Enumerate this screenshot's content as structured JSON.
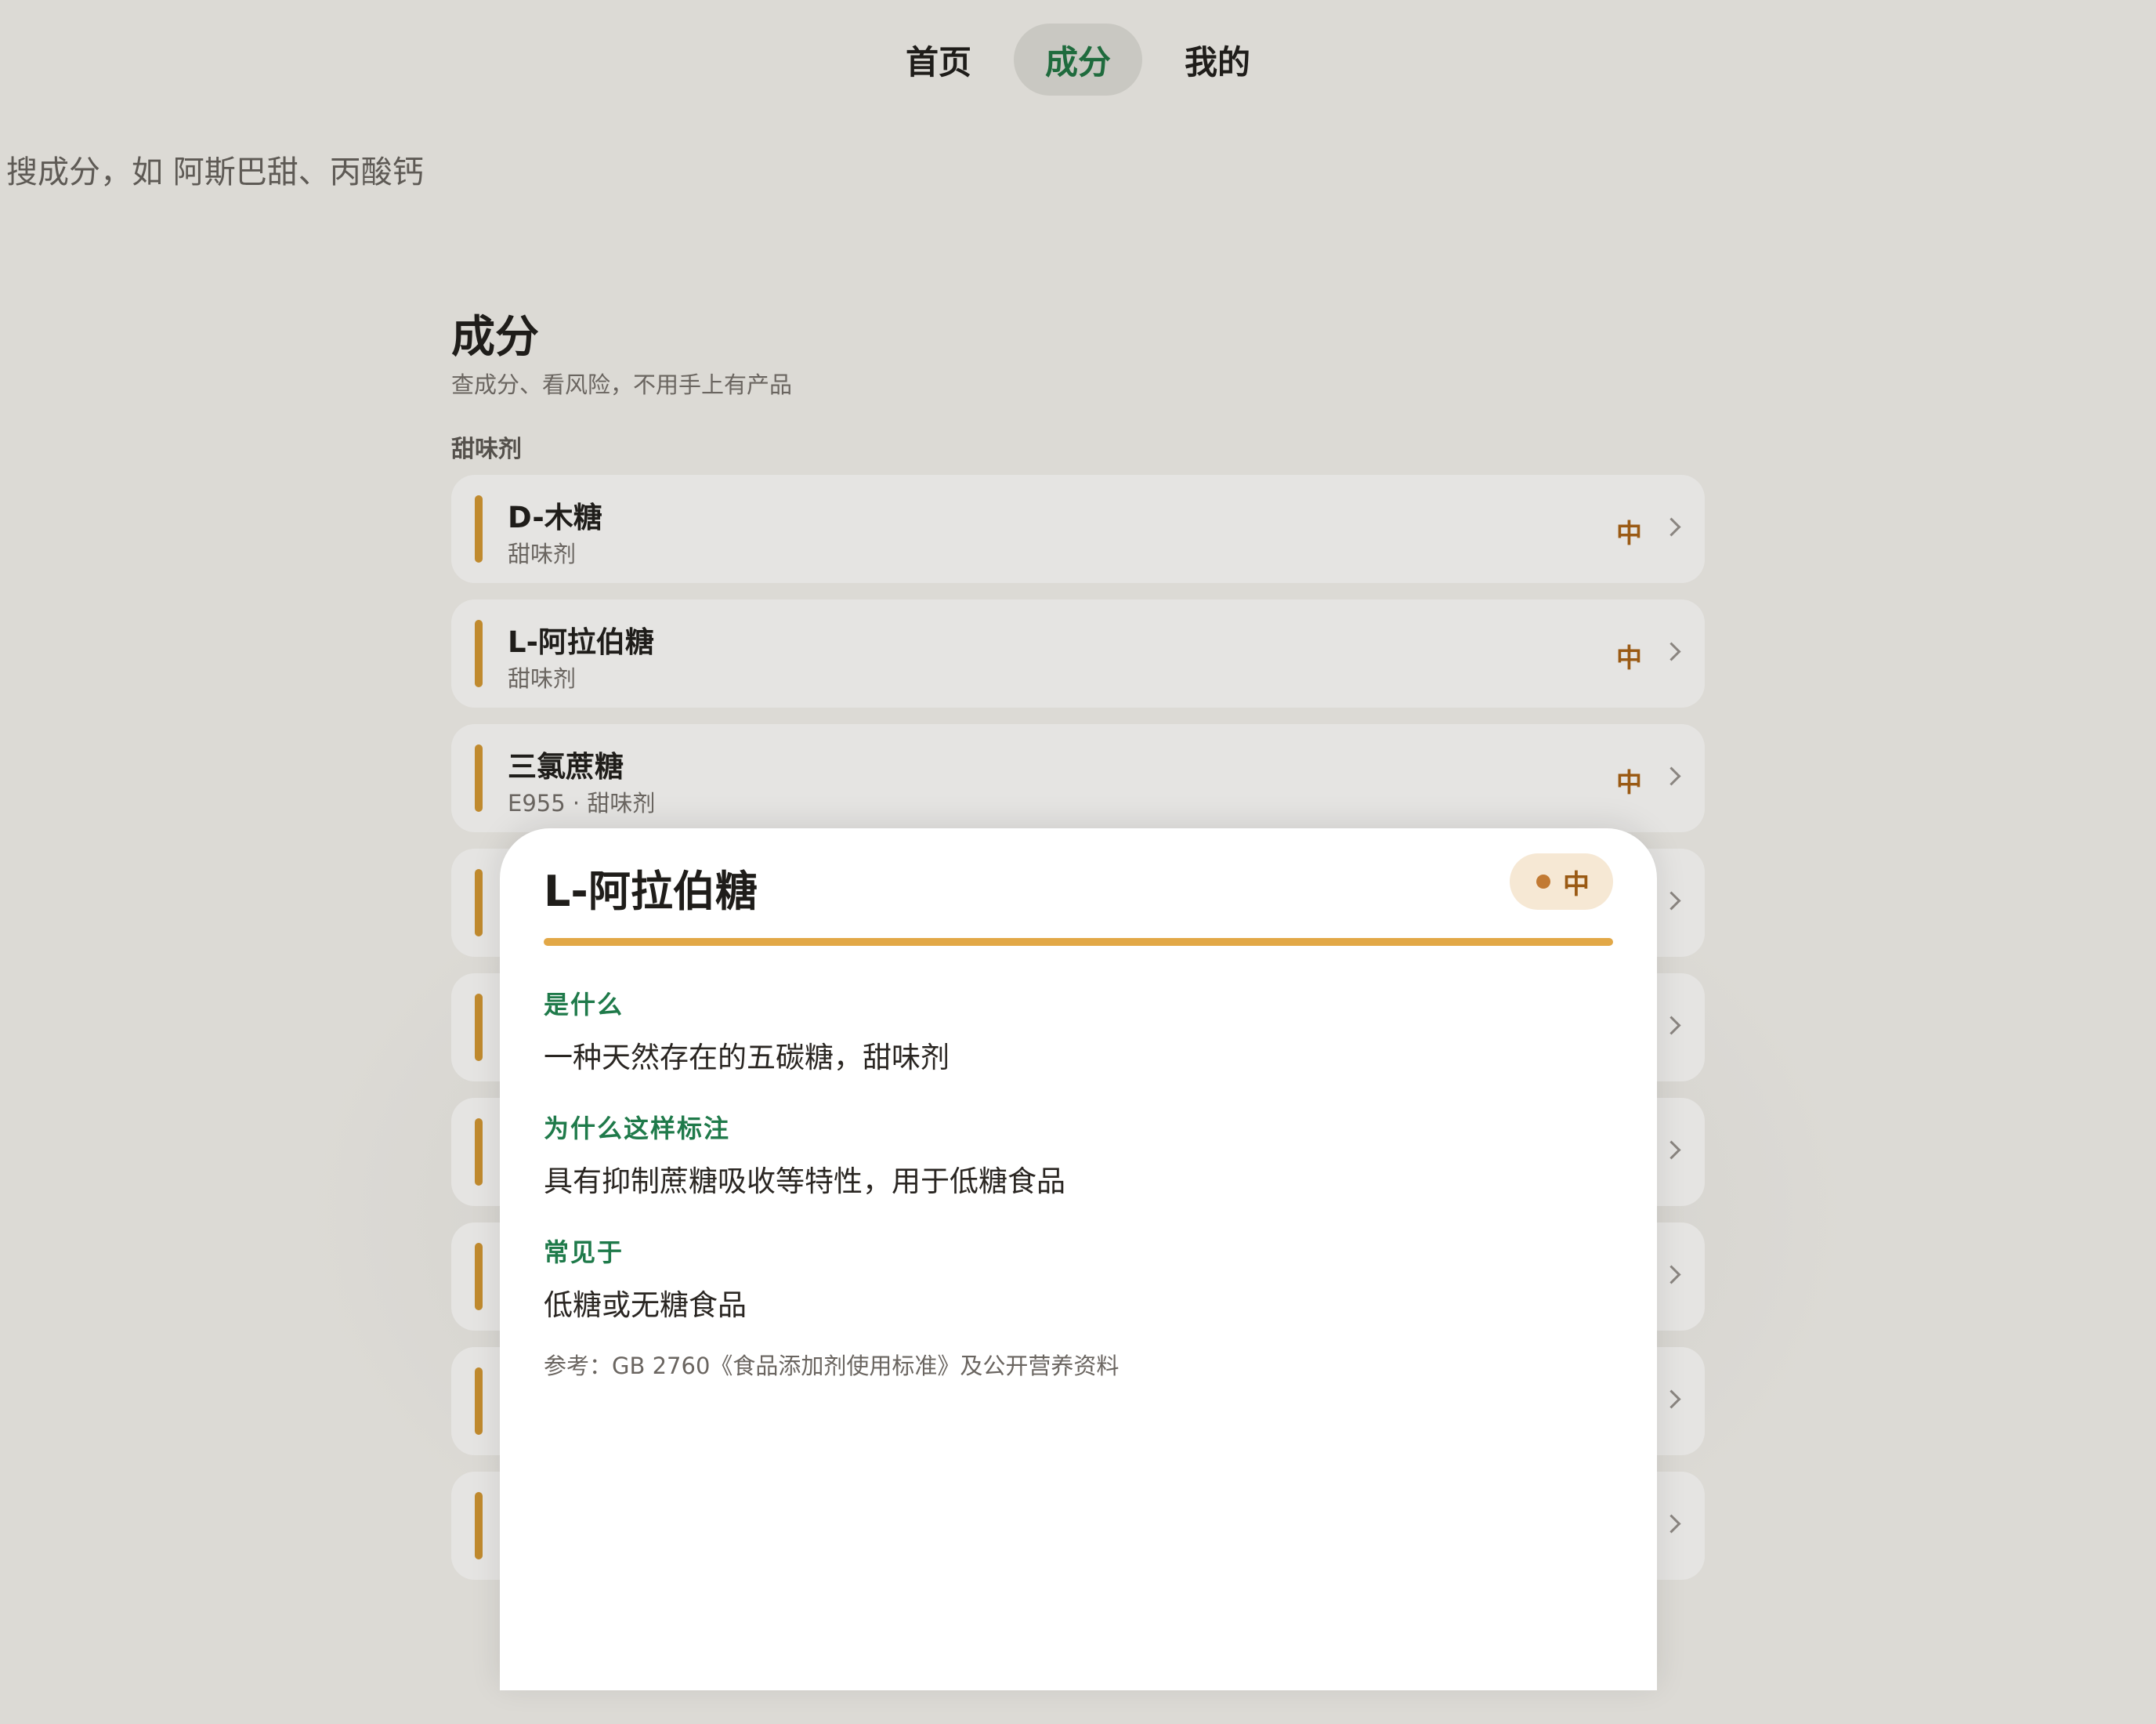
{
  "nav": {
    "tabs": [
      {
        "label": "首页",
        "active": false
      },
      {
        "label": "成分",
        "active": true
      },
      {
        "label": "我的",
        "active": false
      }
    ]
  },
  "search": {
    "placeholder": "搜成分，如 阿斯巴甜、丙酸钙",
    "value": ""
  },
  "page": {
    "title": "成分",
    "subtitle": "查成分、看风险，不用手上有产品"
  },
  "section": {
    "label": "甜味剂"
  },
  "ingredients": [
    {
      "name": "D-木糖",
      "sub": "甜味剂",
      "risk": "中"
    },
    {
      "name": "L-阿拉伯糖",
      "sub": "甜味剂",
      "risk": "中"
    },
    {
      "name": "三氯蔗糖",
      "sub": "E955 · 甜味剂",
      "risk": "中"
    },
    {
      "name": "",
      "sub": "",
      "risk": ""
    },
    {
      "name": "",
      "sub": "",
      "risk": ""
    },
    {
      "name": "",
      "sub": "",
      "risk": ""
    },
    {
      "name": "",
      "sub": "",
      "risk": ""
    },
    {
      "name": "",
      "sub": "",
      "risk": ""
    },
    {
      "name": "",
      "sub": "",
      "risk": ""
    }
  ],
  "detail": {
    "title": "L-阿拉伯糖",
    "risk_label": "中",
    "risk_level_fraction": 1.0,
    "sections": [
      {
        "heading": "是什么",
        "body": "一种天然存在的五碳糖，甜味剂"
      },
      {
        "heading": "为什么这样标注",
        "body": "具有抑制蔗糖吸收等特性，用于低糖食品"
      },
      {
        "heading": "常见于",
        "body": "低糖或无糖食品"
      }
    ],
    "reference": "参考：GB 2760《食品添加剂使用标准》及公开营养资料"
  },
  "colors": {
    "background": "#dcdad5",
    "accent_green": "#1f7a4a",
    "risk_medium": "#c08a2e",
    "risk_meter": "#e2a847",
    "risk_pill_bg": "#f6e8d4",
    "card_bg": "#e5e4e2",
    "sheet_bg": "#ffffff"
  },
  "icons": {
    "row_action": "chevron-right-icon",
    "risk_indicator": "risk-dot-icon"
  }
}
